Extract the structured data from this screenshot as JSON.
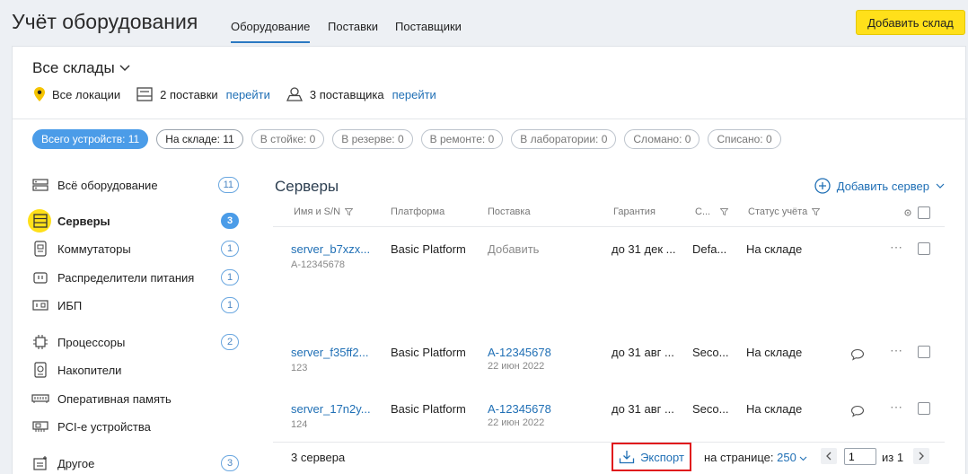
{
  "app": {
    "title": "Учёт оборудования"
  },
  "tabs": [
    {
      "label": "Оборудование",
      "active": true
    },
    {
      "label": "Поставки",
      "active": false
    },
    {
      "label": "Поставщики",
      "active": false
    }
  ],
  "add_warehouse_label": "Добавить склад",
  "warehouse": {
    "selected": "Все склады"
  },
  "meta": {
    "locations": "Все локации",
    "supplies": "2 поставки",
    "supplies_link": "перейти",
    "suppliers": "3 поставщика",
    "suppliers_link": "перейти"
  },
  "filters": [
    "Всего устройств: 11",
    "На складе: 11",
    "В стойке: 0",
    "В резерве: 0",
    "В ремонте: 0",
    "В лаборатории: 0",
    "Сломано: 0",
    "Списано: 0"
  ],
  "sidebar": {
    "items": [
      {
        "label": "Всё оборудование",
        "count": "11",
        "icon": "all-equipment-icon"
      },
      {
        "label": "Серверы",
        "count": "3",
        "icon": "server-icon",
        "active": true
      },
      {
        "label": "Коммутаторы",
        "count": "1",
        "icon": "switch-icon"
      },
      {
        "label": "Распределители питания",
        "count": "1",
        "icon": "pdu-icon"
      },
      {
        "label": "ИБП",
        "count": "1",
        "icon": "ups-icon"
      },
      {
        "label": "Процессоры",
        "count": "2",
        "icon": "cpu-icon"
      },
      {
        "label": "Накопители",
        "count": "",
        "icon": "storage-icon"
      },
      {
        "label": "Оперативная память",
        "count": "",
        "icon": "ram-icon"
      },
      {
        "label": "PCI-e устройства",
        "count": "",
        "icon": "pcie-icon"
      },
      {
        "label": "Другое",
        "count": "3",
        "icon": "other-icon"
      }
    ]
  },
  "section": {
    "title": "Серверы",
    "add_label": "Добавить сервер"
  },
  "table": {
    "columns": [
      "Имя и S/N",
      "Платформа",
      "Поставка",
      "Гарантия",
      "С...",
      "Статус учёта"
    ],
    "rows": [
      {
        "name": "server_b7xzx...",
        "sn": "A-12345678",
        "platform": "Basic Platform",
        "supply": "Добавить",
        "supply_date": "",
        "warranty": "до 31 дек ...",
        "c": "Defa...",
        "status": "На складе",
        "comment": false
      },
      {
        "name": "server_f35ff2...",
        "sn": "123",
        "platform": "Basic Platform",
        "supply": "A-12345678",
        "supply_date": "22 июн 2022",
        "warranty": "до 31 авг ...",
        "c": "Seco...",
        "status": "На складе",
        "comment": true
      },
      {
        "name": "server_17n2y...",
        "sn": "124",
        "platform": "Basic Platform",
        "supply": "A-12345678",
        "supply_date": "22 июн 2022",
        "warranty": "до 31 авг ...",
        "c": "Seco...",
        "status": "На складе",
        "comment": true
      }
    ]
  },
  "footer": {
    "count": "3 сервера",
    "export_label": "Экспорт",
    "per_page_label": "на странице:",
    "per_page_value": "250",
    "page": "1",
    "of_label": "из 1"
  },
  "colors": {
    "accent": "#1f6fb5",
    "brand_yellow": "#ffe01a",
    "chip_active": "#4b9ce8",
    "highlight_border": "#e0161c"
  }
}
